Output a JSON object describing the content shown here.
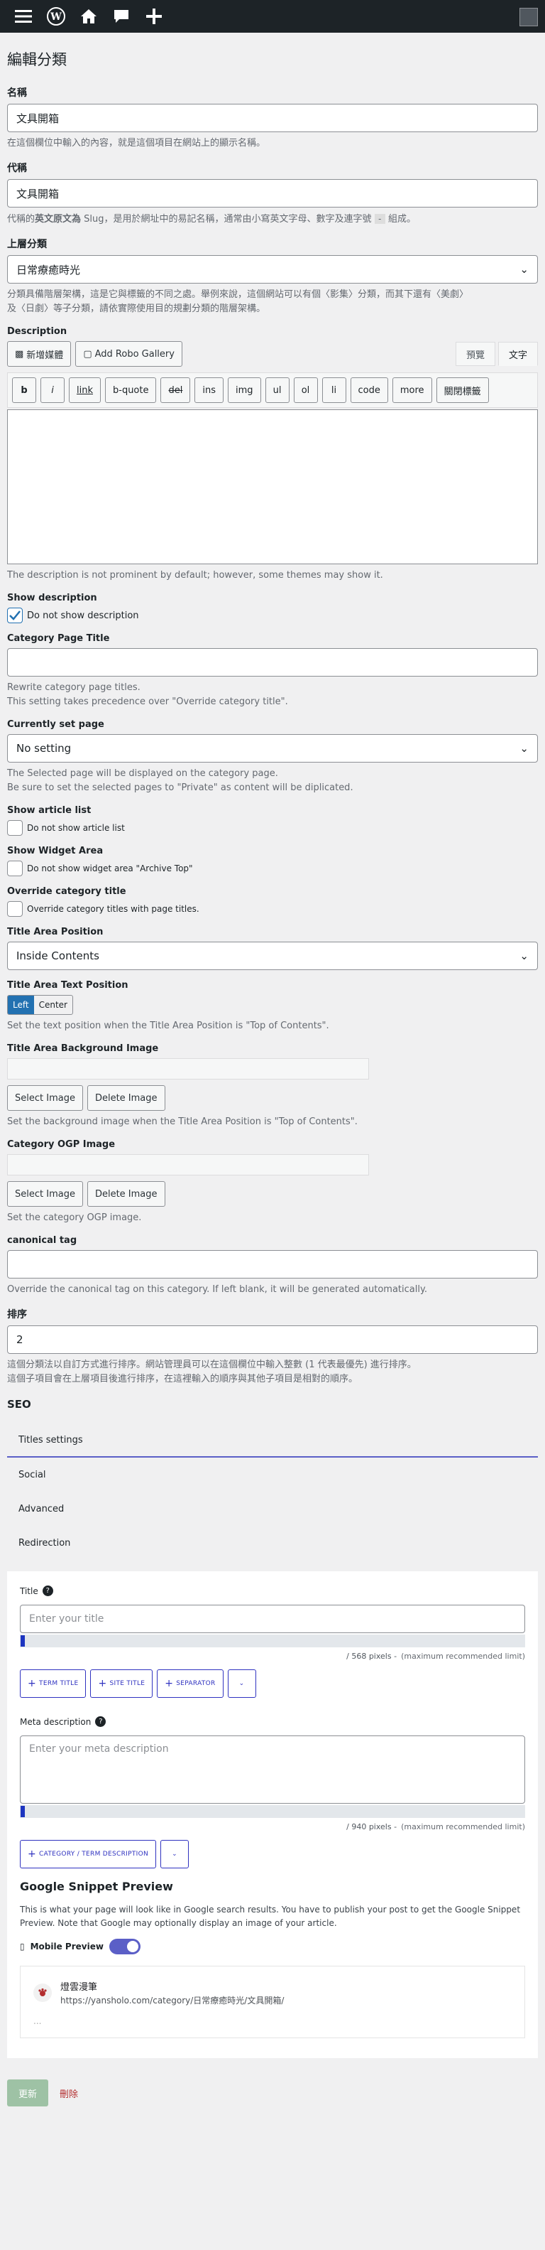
{
  "page_title": "編輯分類",
  "name": {
    "label": "名稱",
    "value": "文具開箱",
    "desc": "在這個欄位中輸入的內容，就是這個項目在網站上的顯示名稱。"
  },
  "slug": {
    "label": "代稱",
    "value": "文具開箱",
    "desc_a": "代稱的",
    "desc_b": "英文原文為",
    "desc_c": " Slug，是用於網址中的易記名稱，通常由小寫英文字母、數字及連字號 ",
    "desc_code": "-",
    "desc_d": " 組成。"
  },
  "parent": {
    "label": "上層分類",
    "value": "日常療癒時光",
    "desc_line1": "分類具備階層架構，這是它與標籤的不同之處。舉例來說，這個網站可以有個〈影集〉分類，而其下還有〈美劇〉",
    "desc_line2": "及〈日劇〉等子分類，請依實際使用目的規劃分類的階層架構。"
  },
  "description": {
    "label": "Description",
    "add_media": "新增媒體",
    "add_gallery": "Add Robo Gallery",
    "tab_visual": "預覽",
    "tab_text": "文字",
    "quicktags": [
      "b",
      "i",
      "link",
      "b-quote",
      "del",
      "ins",
      "img",
      "ul",
      "ol",
      "li",
      "code",
      "more",
      "關閉標籤"
    ],
    "help": "The description is not prominent by default; however, some themes may show it."
  },
  "show_description": {
    "label": "Show description",
    "checkbox": "Do not show description"
  },
  "category_page_title": {
    "label": "Category Page Title",
    "desc1": "Rewrite category page titles.",
    "desc2": "This setting takes precedence over \"Override category title\"."
  },
  "currently_set_page": {
    "label": "Currently set page",
    "value": "No setting",
    "desc1": "The Selected page will be displayed on the category page.",
    "desc2": "Be sure to set the selected pages to \"Private\" as content will be diplicated."
  },
  "show_article_list": {
    "label": "Show article list",
    "checkbox": "Do not show article list"
  },
  "show_widget_area": {
    "label": "Show Widget Area",
    "checkbox": "Do not show widget area \"Archive Top\""
  },
  "override_category_title": {
    "label": "Override category title",
    "checkbox": "Override category titles with page titles."
  },
  "title_area_position": {
    "label": "Title Area Position",
    "value": "Inside Contents"
  },
  "title_area_text_position": {
    "label": "Title Area Text Position",
    "opt_left": "Left",
    "opt_center": "Center",
    "desc": "Set the text position when the Title Area Position is \"Top of Contents\"."
  },
  "title_area_bg_image": {
    "label": "Title Area Background Image",
    "select": "Select Image",
    "delete": "Delete Image",
    "desc": "Set the background image when the Title Area Position is \"Top of Contents\"."
  },
  "category_ogp_image": {
    "label": "Category OGP Image",
    "select": "Select Image",
    "delete": "Delete Image",
    "desc": "Set the category OGP image."
  },
  "canonical_tag": {
    "label": "canonical tag",
    "desc": "Override the canonical tag on this category. If left blank, it will be generated automatically."
  },
  "order": {
    "label": "排序",
    "value": "2",
    "desc1": "這個分類法以自訂方式進行排序。網站管理員可以在這個欄位中輸入整數 (1 代表最優先) 進行排序。",
    "desc2": "這個子項目會在上層項目後進行排序，在這裡輸入的順序與其他子項目是相對的順序。"
  },
  "seo": {
    "heading": "SEO",
    "tabs": [
      "Titles settings",
      "Social",
      "Advanced",
      "Redirection"
    ],
    "title_label": "Title",
    "title_placeholder": "Enter your title",
    "title_pixels": "/ 568 pixels -",
    "title_limit": "(maximum recommended limit)",
    "tag_term_title": "TERM TITLE",
    "tag_site_title": "SITE TITLE",
    "tag_separator": "SEPARATOR",
    "meta_label": "Meta description",
    "meta_placeholder": "Enter your meta description",
    "meta_pixels": "/ 940 pixels -",
    "meta_limit": "(maximum recommended limit)",
    "tag_cat_desc": "CATEGORY / TERM DESCRIPTION",
    "snippet_heading": "Google Snippet Preview",
    "snippet_desc": "This is what your page will look like in Google search results. You have to publish your post to get the Google Snippet Preview. Note that Google may optionally display an image of your article.",
    "mobile_preview": "Mobile Preview",
    "snippet_site": "燈雲漫筆",
    "snippet_url": "https://yansholo.com/category/日常療癒時光/文具開箱/",
    "snippet_dots": "..."
  },
  "actions": {
    "update": "更新",
    "delete": "刪除"
  },
  "colors": {
    "accent": "#2271b1",
    "seo_accent": "#5b5fc7",
    "admin_bar": "#1d2327"
  }
}
